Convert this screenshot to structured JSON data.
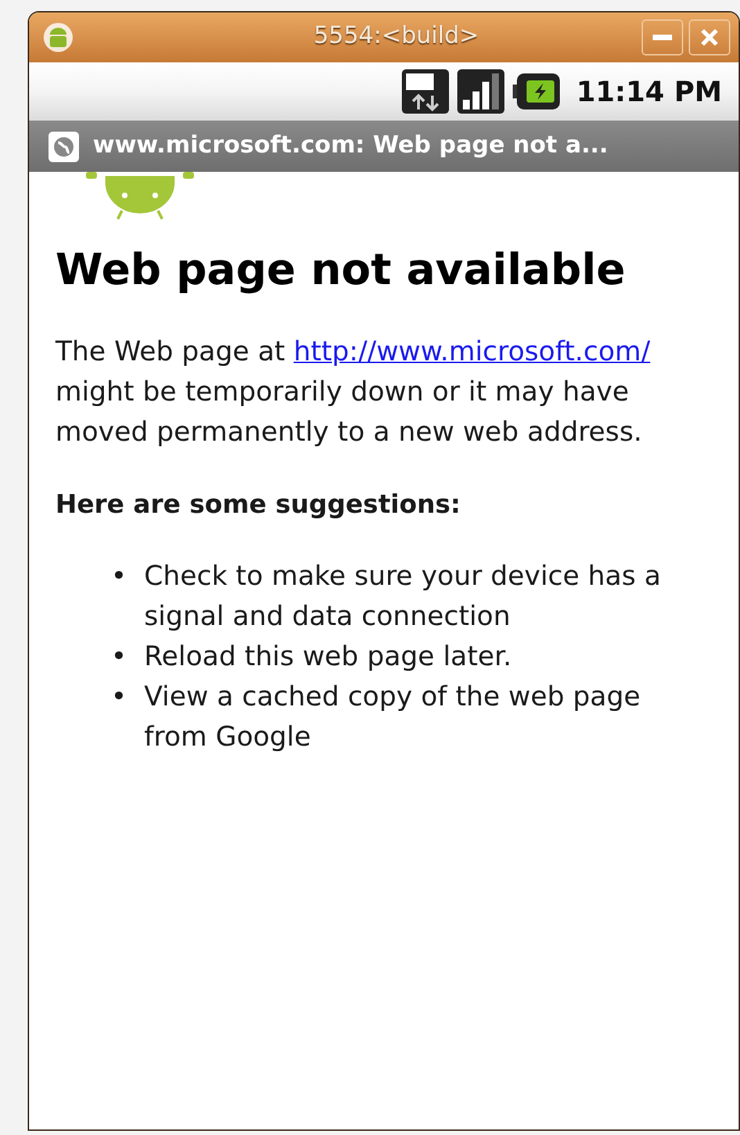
{
  "window": {
    "title": "5554:<build>"
  },
  "status_bar": {
    "time": "11:14 PM"
  },
  "page_title": "www.microsoft.com: Web page not a...",
  "heading": "Web page not available",
  "message": {
    "before": "The Web page at ",
    "link": "http://www.microsoft.com/",
    "after": " might be temporarily down or it may have moved permanently to a new web address."
  },
  "suggestions_heading": "Here are some suggestions:",
  "suggestions": [
    {
      "bullet": "•",
      "text": "Check to make sure your device has a signal and data connection"
    },
    {
      "bullet": "•",
      "text": "Reload this web page later."
    },
    {
      "bullet": "•",
      "text": "View a cached copy of the web page from Google"
    }
  ]
}
